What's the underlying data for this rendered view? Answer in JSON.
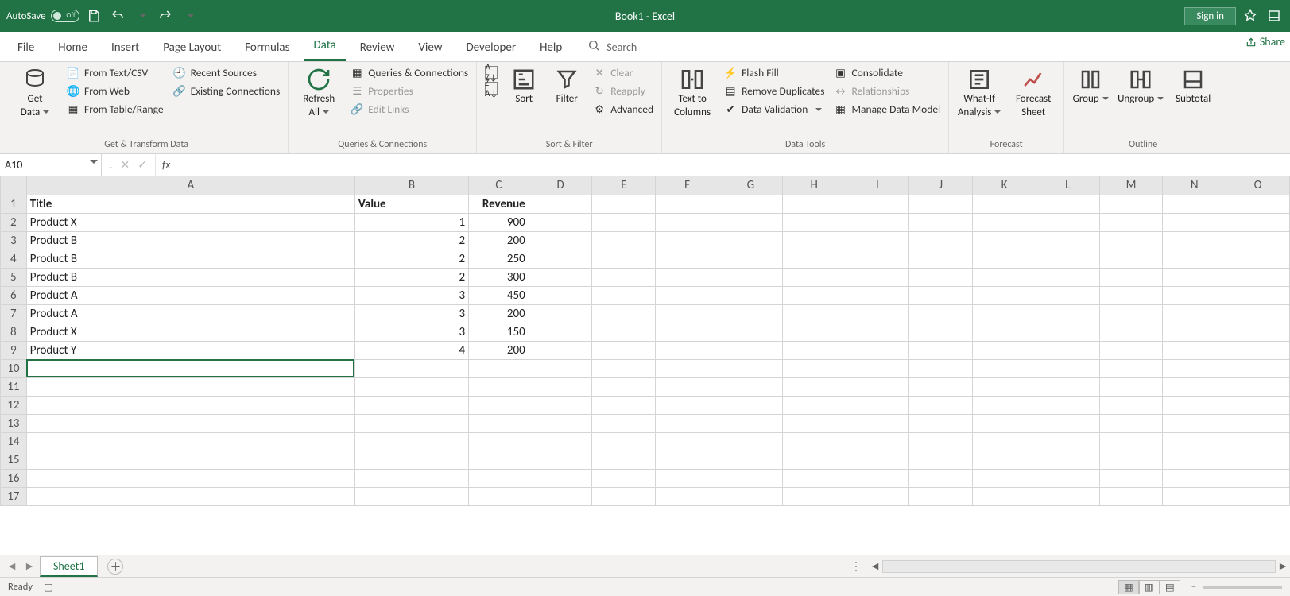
{
  "titlebar": {
    "autosave_label": "AutoSave",
    "autosave_state": "Off",
    "title": "Book1  -  Excel",
    "signin": "Sign in"
  },
  "tabs": {
    "items": [
      "File",
      "Home",
      "Insert",
      "Page Layout",
      "Formulas",
      "Data",
      "Review",
      "View",
      "Developer",
      "Help"
    ],
    "active": "Data",
    "search_placeholder": "Search",
    "share": "Share"
  },
  "ribbon": {
    "groups": [
      {
        "label": "Get & Transform Data",
        "big": {
          "line1": "Get",
          "line2": "Data"
        },
        "cmds": [
          "From Text/CSV",
          "From Web",
          "From Table/Range",
          "Recent Sources",
          "Existing Connections"
        ]
      },
      {
        "label": "Queries & Connections",
        "big": {
          "line1": "Refresh",
          "line2": "All"
        },
        "cmds": [
          "Queries & Connections",
          "Properties",
          "Edit Links"
        ]
      },
      {
        "label": "Sort & Filter",
        "bigs": [
          "Sort",
          "Filter"
        ],
        "cmds": [
          "Clear",
          "Reapply",
          "Advanced"
        ]
      },
      {
        "label": "Data Tools",
        "big": {
          "line1": "Text to",
          "line2": "Columns"
        },
        "cmdsL": [
          "Flash Fill",
          "Remove Duplicates",
          "Data Validation"
        ],
        "cmdsR": [
          "Consolidate",
          "Relationships",
          "Manage Data Model"
        ]
      },
      {
        "label": "Forecast",
        "bigs2": [
          {
            "l1": "What-If",
            "l2": "Analysis"
          },
          {
            "l1": "Forecast",
            "l2": "Sheet"
          }
        ]
      },
      {
        "label": "Outline",
        "bigs3": [
          "Group",
          "Ungroup",
          "Subtotal"
        ]
      }
    ]
  },
  "formula_bar": {
    "name": "A10",
    "formula": ""
  },
  "sheet": {
    "columns": [
      "A",
      "B",
      "C",
      "D",
      "E",
      "F",
      "G",
      "H",
      "I",
      "J",
      "K",
      "L",
      "M",
      "N",
      "O"
    ],
    "row_count": 17,
    "selected_cell": "A10",
    "data": {
      "1": {
        "A": "Title",
        "B": "Value",
        "C": "Revenue"
      },
      "2": {
        "A": "Product X",
        "B": "1",
        "C": "900"
      },
      "3": {
        "A": "Product B",
        "B": "2",
        "C": "200"
      },
      "4": {
        "A": "Product B",
        "B": "2",
        "C": "250"
      },
      "5": {
        "A": "Product B",
        "B": "2",
        "C": "300"
      },
      "6": {
        "A": "Product A",
        "B": "3",
        "C": "450"
      },
      "7": {
        "A": "Product A",
        "B": "3",
        "C": "200"
      },
      "8": {
        "A": "Product X",
        "B": "3",
        "C": "150"
      },
      "9": {
        "A": "Product Y",
        "B": "4",
        "C": "200"
      }
    }
  },
  "sheet_tabs": {
    "active": "Sheet1"
  },
  "status": {
    "state": "Ready"
  }
}
